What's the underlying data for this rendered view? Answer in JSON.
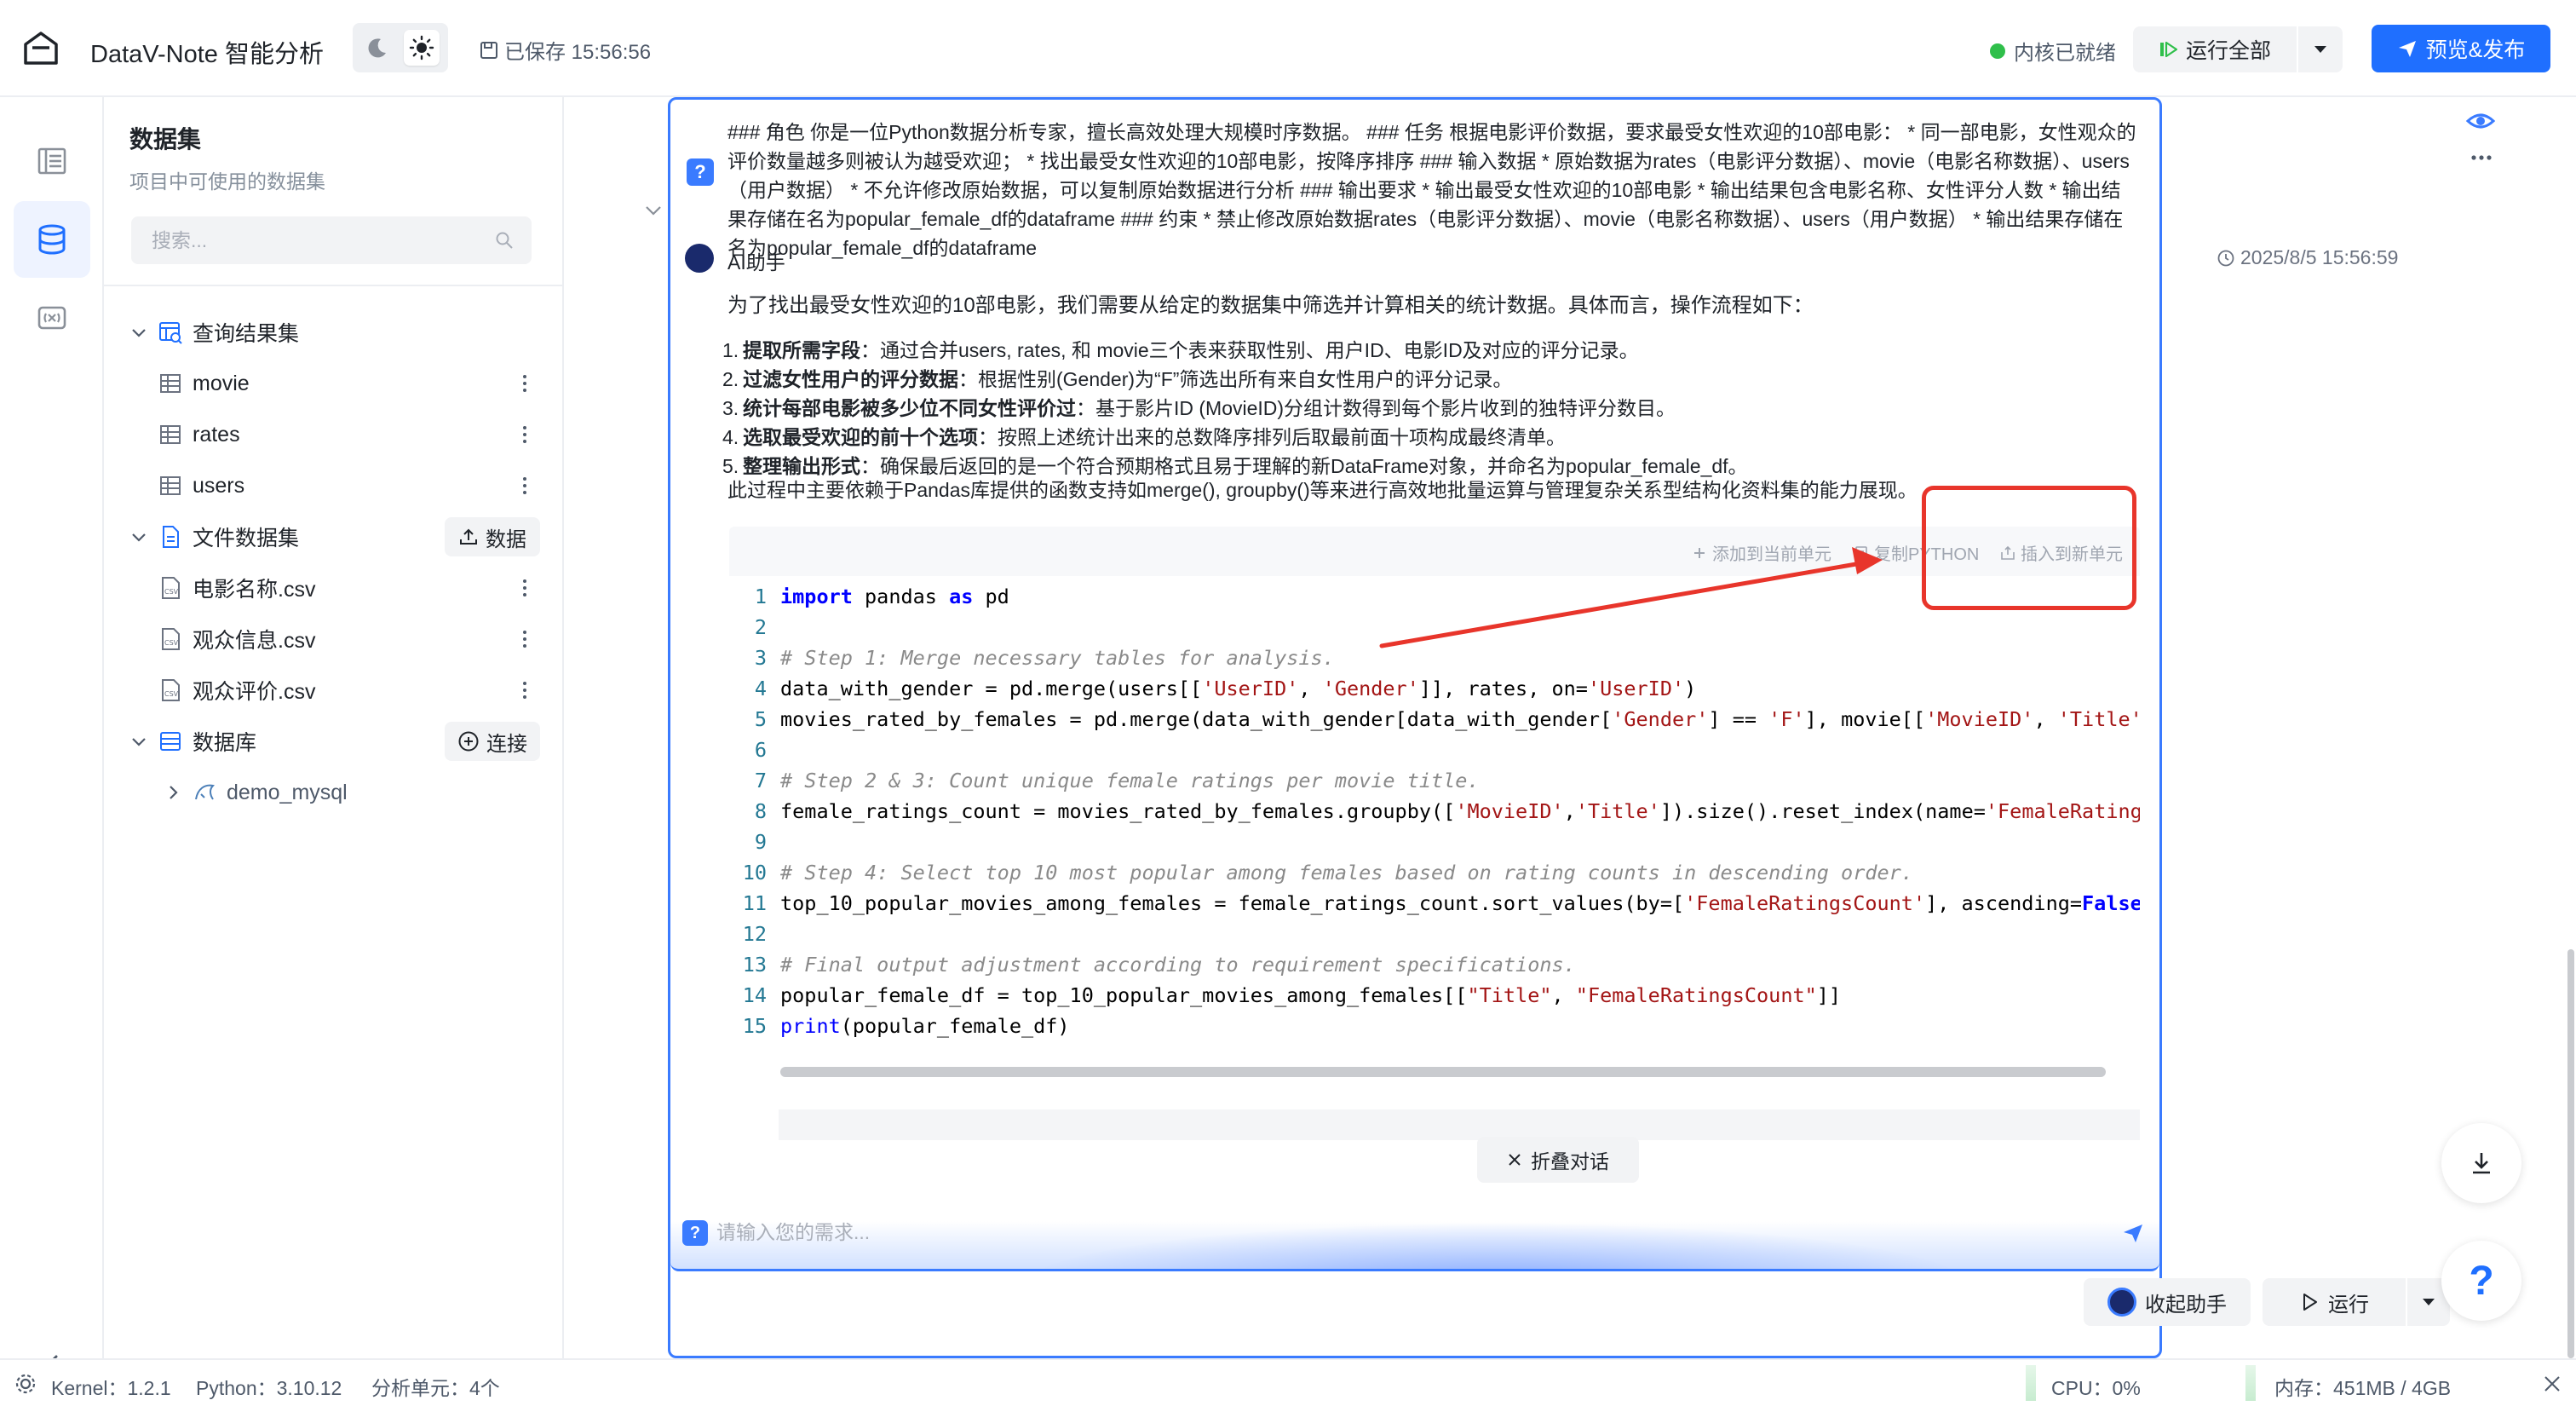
{
  "header": {
    "app_title": "DataV-Note 智能分析",
    "save_status": "已保存 15:56:56",
    "kernel_status": "内核已就绪",
    "run_all_label": "运行全部",
    "publish_label": "预览&发布"
  },
  "panel": {
    "title": "数据集",
    "subtitle": "项目中可使用的数据集",
    "search_placeholder": "搜索...",
    "groups": {
      "query_results": {
        "label": "查询结果集",
        "items": [
          "movie",
          "rates",
          "users"
        ]
      },
      "file_datasets": {
        "label": "文件数据集",
        "button_label": "数据",
        "items": [
          "电影名称.csv",
          "观众信息.csv",
          "观众评价.csv"
        ]
      },
      "databases": {
        "label": "数据库",
        "button_label": "连接",
        "items": [
          "demo_mysql"
        ]
      }
    }
  },
  "prompt": {
    "text": "### 角色 你是一位Python数据分析专家，擅长高效处理大规模时序数据。 ### 任务 根据电影评价数据，要求最受女性欢迎的10部电影： * 同一部电影，女性观众的评价数量越多则被认为越受欢迎； * 找出最受女性欢迎的10部电影，按降序排序 ### 输入数据 * 原始数据为rates（电影评分数据）、movie（电影名称数据）、users（用户数据） * 不允许修改原始数据，可以复制原始数据进行分析 ### 输出要求 * 输出最受女性欢迎的10部电影 * 输出结果包含电影名称、女性评分人数 * 输出结果存储在名为popular_female_df的dataframe ### 约束 * 禁止修改原始数据rates（电影评分数据）、movie（电影名称数据）、users（用户数据） * 输出结果存储在名为popular_female_df的dataframe"
  },
  "assistant": {
    "name": "AI助手",
    "timestamp": "2025/8/5 15:56:59",
    "intro": "为了找出最受女性欢迎的10部电影，我们需要从给定的数据集中筛选并计算相关的统计数据。具体而言，操作流程如下：",
    "steps": [
      {
        "num": "1.",
        "bold": "提取所需字段",
        "text": "：通过合并users, rates, 和 movie三个表来获取性别、用户ID、电影ID及对应的评分记录。"
      },
      {
        "num": "2.",
        "bold": "过滤女性用户的评分数据",
        "text": "：根据性别(Gender)为“F”筛选出所有来自女性用户的评分记录。"
      },
      {
        "num": "3.",
        "bold": "统计每部电影被多少位不同女性评价过",
        "text": "：基于影片ID (MovieID)分组计数得到每个影片收到的独特评分数目。"
      },
      {
        "num": "4.",
        "bold": "选取最受欢迎的前十个选项",
        "text": "：按照上述统计出来的总数降序排列后取最前面十项构成最终清单。"
      },
      {
        "num": "5.",
        "bold": "整理输出形式",
        "text": "：确保最后返回的是一个符合预期格式且易于理解的新DataFrame对象，并命名为popular_female_df。"
      }
    ],
    "outro": "此过程中主要依赖于Pandas库提供的函数支持如merge(), groupby()等来进行高效地批量运算与管理复杂关系型结构化资料集的能力展现。"
  },
  "code_toolbar": {
    "add_to_cell": "添加到当前单元",
    "copy_python": "复制PYTHON",
    "insert_new_cell": "插入到新单元"
  },
  "code": {
    "line_numbers": [
      "1",
      "2",
      "3",
      "4",
      "5",
      "6",
      "7",
      "8",
      "9",
      "10",
      "11",
      "12",
      "13",
      "14",
      "15"
    ]
  },
  "chat": {
    "fold_label": "折叠对话",
    "input_placeholder": "请输入您的需求...",
    "collapse_assistant": "收起助手",
    "run_label": "运行"
  },
  "status_bar": {
    "kernel": "Kernel：1.2.1",
    "python": "Python：3.10.12",
    "cells": "分析单元：4个",
    "cpu": "CPU：0%",
    "memory": "内存：451MB / 4GB"
  },
  "colors": {
    "accent": "#1f6fff",
    "cell_border": "#3a7bff",
    "highlight": "#e8352b",
    "kernel_ok": "#2fbf4a"
  }
}
